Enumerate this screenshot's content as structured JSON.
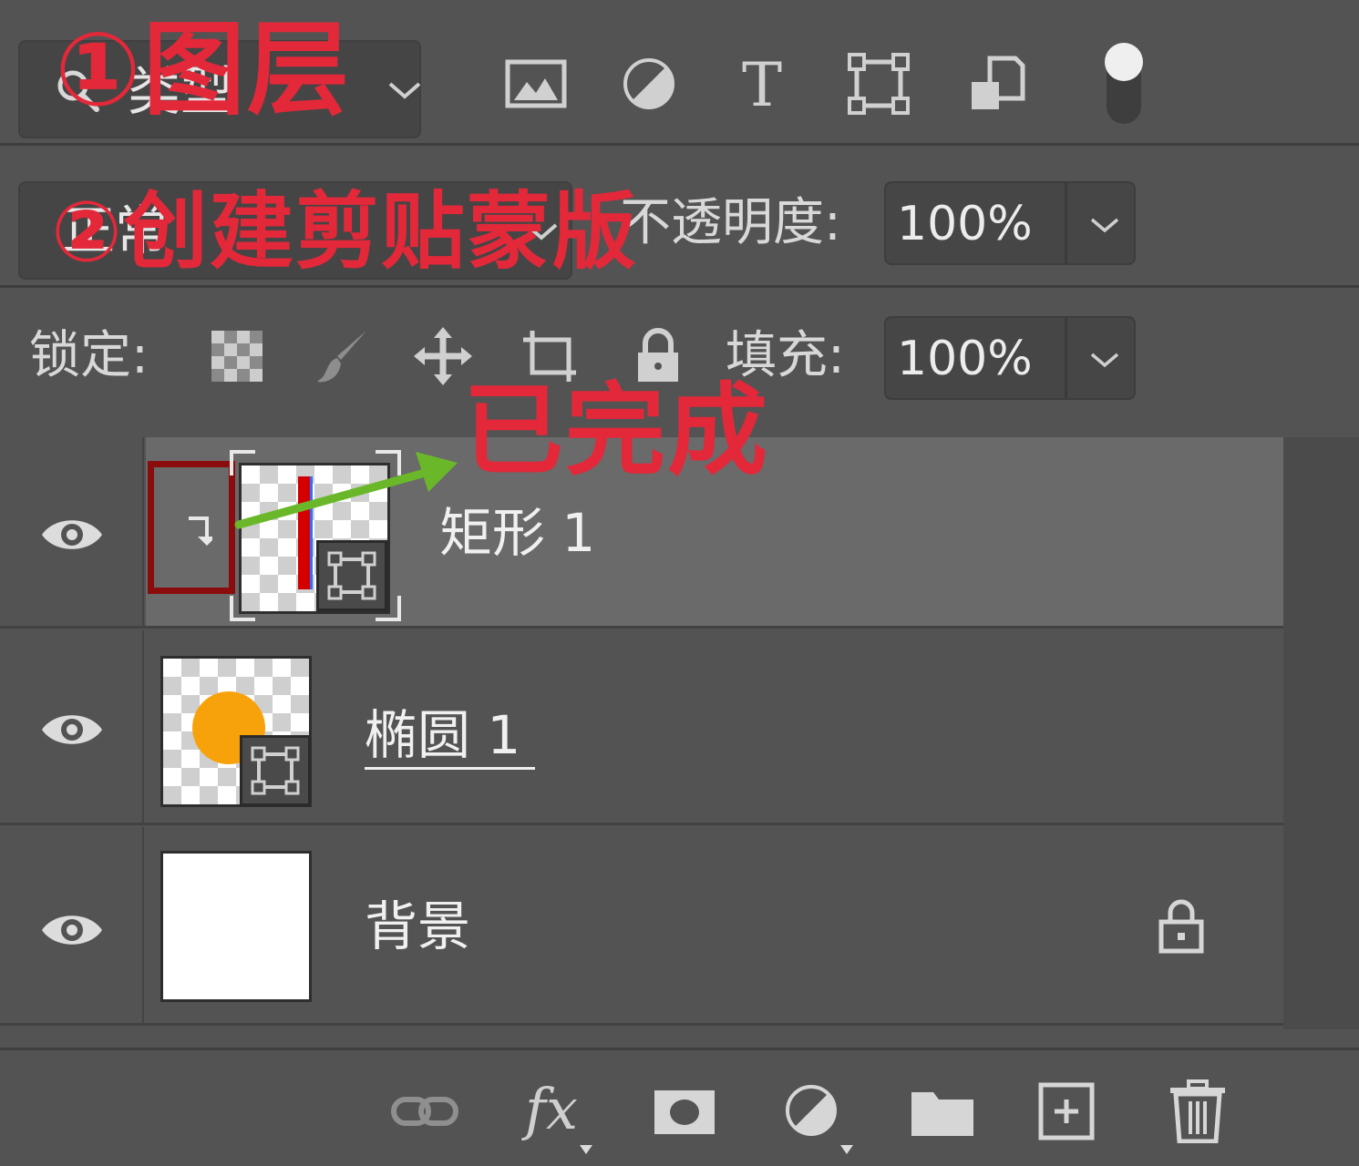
{
  "filter": {
    "kind_label": "类型",
    "icons": [
      "image-filter-icon",
      "adjustment-filter-icon",
      "type-filter-icon",
      "shape-filter-icon",
      "smart-object-filter-icon"
    ],
    "type_glyph": "T"
  },
  "blend": {
    "mode_label": "正常",
    "opacity_label": "不透明度:",
    "opacity_value": "100%"
  },
  "lock": {
    "label": "锁定:",
    "fill_label": "填充:",
    "fill_value": "100%"
  },
  "layers": [
    {
      "name": "矩形 1",
      "selected": true,
      "clipped": true
    },
    {
      "name": "椭圆 1",
      "selected": false,
      "clipped": false
    },
    {
      "name": "背景",
      "selected": false,
      "locked": true
    }
  ],
  "bottom_bar": {
    "fx_label": "fx"
  },
  "annotations": {
    "step1": "①图层",
    "step2": "②创建剪贴蒙版",
    "done": "已完成"
  },
  "colors": {
    "panel_bg": "#535353",
    "selected_row": "#6a6a6a",
    "annotation_red": "#e3283a",
    "annotation_green": "#6ab82a",
    "ellipse_orange": "#f7a20a",
    "rect_red": "#d40000"
  }
}
